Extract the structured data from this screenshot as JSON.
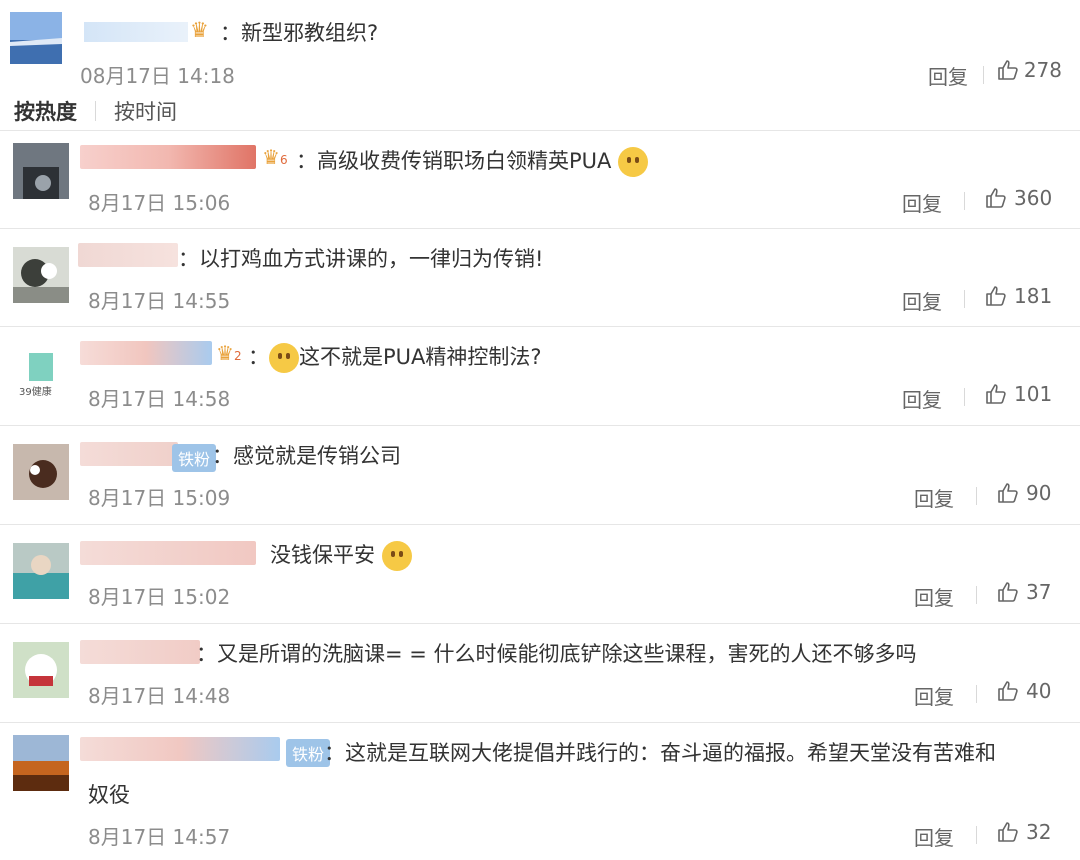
{
  "top_comment": {
    "text": "新型邪教组织?",
    "time": "08月17日 14:18",
    "reply_label": "回复",
    "likes": "278"
  },
  "sort_tabs": {
    "hot": "按热度",
    "time": "按时间"
  },
  "comments": [
    {
      "text": "高级收费传销职场白领精英PUA",
      "time": "8月17日 15:06",
      "reply_label": "回复",
      "likes": "360",
      "badge": "6"
    },
    {
      "text": "以打鸡血方式讲课的，一律归为传销!",
      "time": "8月17日 14:55",
      "reply_label": "回复",
      "likes": "181"
    },
    {
      "text": "这不就是PUA精神控制法?",
      "time": "8月17日 14:58",
      "reply_label": "回复",
      "likes": "101",
      "badge": "2",
      "avatar_text": "39健康"
    },
    {
      "text": "感觉就是传销公司",
      "time": "8月17日 15:09",
      "reply_label": "回复",
      "likes": "90",
      "fan_label": "铁粉"
    },
    {
      "text": "没钱保平安",
      "time": "8月17日 15:02",
      "reply_label": "回复",
      "likes": "37"
    },
    {
      "text": "又是所谓的洗脑课= = 什么时候能彻底铲除这些课程，害死的人还不够多吗",
      "time": "8月17日 14:48",
      "reply_label": "回复",
      "likes": "40"
    },
    {
      "text_line1": "这就是互联网大佬提倡并践行的：奋斗逼的福报。希望天堂没有苦难和",
      "text_line2": "奴役",
      "time": "8月17日 14:57",
      "reply_label": "回复",
      "likes": "32",
      "fan_label": "铁粉"
    }
  ],
  "icons": {
    "crown": "crown-icon",
    "thumb": "thumb-up-icon"
  }
}
